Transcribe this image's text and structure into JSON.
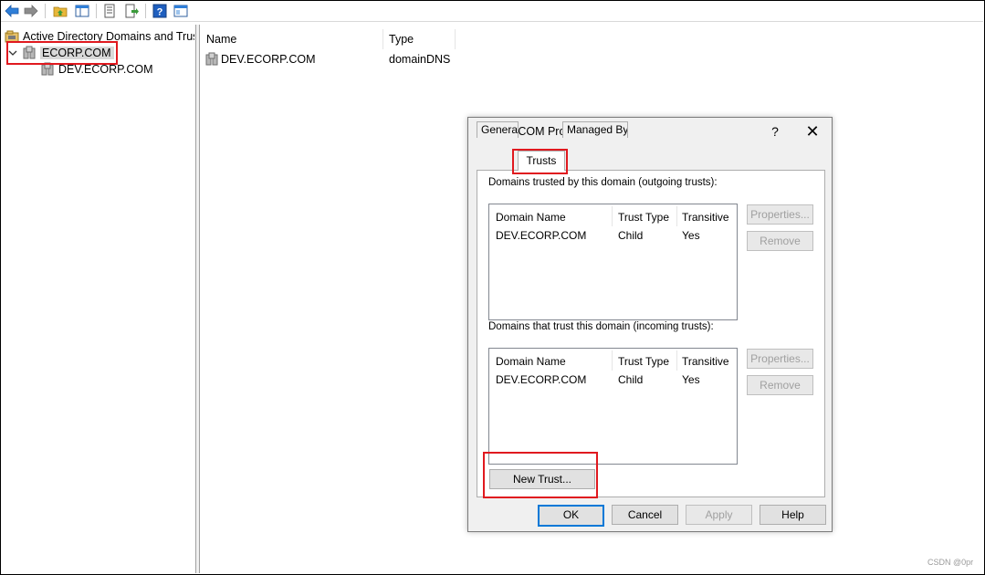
{
  "toolbar": {
    "icons": [
      "back-arrow-icon",
      "forward-arrow-icon",
      "up-folder-icon",
      "show-hide-tree-icon",
      "properties-sheet-icon",
      "export-list-icon",
      "help-icon",
      "console-tree-icon"
    ]
  },
  "tree": {
    "root_label": "Active Directory Domains and Trusts",
    "items": [
      {
        "label": "ECORP.COM",
        "expanded": true,
        "selected": true
      },
      {
        "label": "DEV.ECORP.COM"
      }
    ]
  },
  "list": {
    "columns": [
      "Name",
      "Type"
    ],
    "rows": [
      {
        "name": "DEV.ECORP.COM",
        "type": "domainDNS"
      }
    ]
  },
  "dialog": {
    "title": "ECORP.COM Properties",
    "help_glyph": "?",
    "close_glyph": "✕",
    "tabs": [
      "General",
      "Trusts",
      "Managed By"
    ],
    "active_tab": "Trusts",
    "outgoing_label": "Domains trusted by this domain (outgoing trusts):",
    "incoming_label": "Domains that trust this domain (incoming trusts):",
    "table_columns": [
      "Domain Name",
      "Trust Type",
      "Transitive"
    ],
    "outgoing_rows": [
      {
        "domain": "DEV.ECORP.COM",
        "trust_type": "Child",
        "transitive": "Yes"
      }
    ],
    "incoming_rows": [
      {
        "domain": "DEV.ECORP.COM",
        "trust_type": "Child",
        "transitive": "Yes"
      }
    ],
    "buttons": {
      "properties": "Properties...",
      "remove": "Remove",
      "new_trust": "New Trust...",
      "ok": "OK",
      "cancel": "Cancel",
      "apply": "Apply",
      "help": "Help"
    }
  },
  "colors": {
    "highlight": "#e0191f",
    "focus_border": "#0078d7"
  },
  "watermark": "CSDN @0pr"
}
